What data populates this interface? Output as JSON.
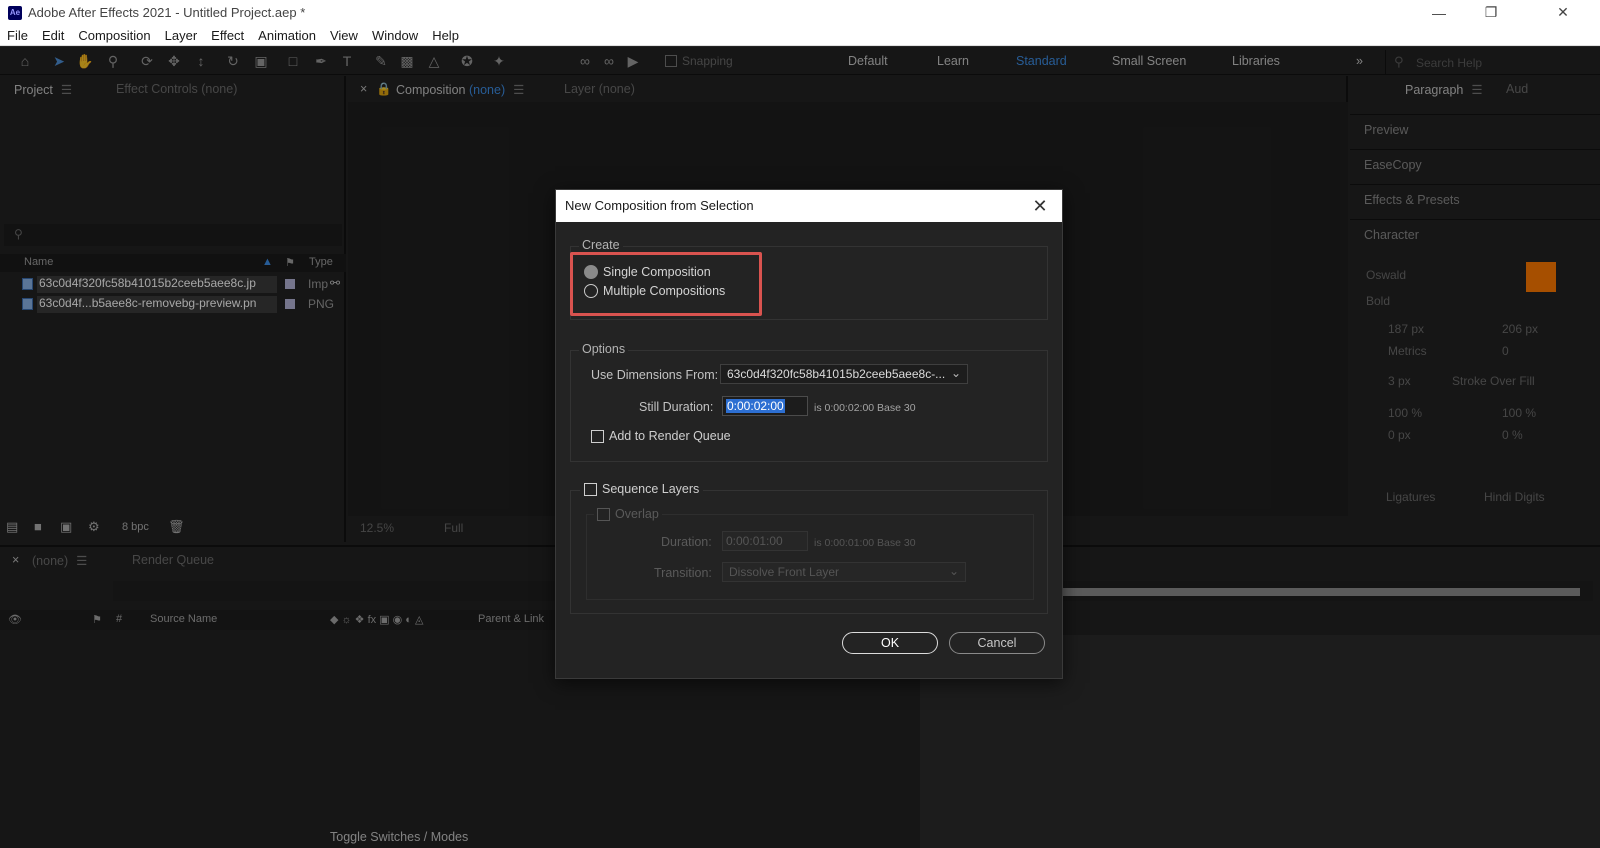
{
  "window": {
    "app_badge": "Ae",
    "title": "Adobe After Effects 2021 - Untitled Project.aep *"
  },
  "menu": [
    "File",
    "Edit",
    "Composition",
    "Layer",
    "Effect",
    "Animation",
    "View",
    "Window",
    "Help"
  ],
  "toolbar": {
    "snapping_label": "Snapping",
    "workspaces": [
      "Default",
      "Learn",
      "Standard",
      "Small Screen",
      "Libraries"
    ],
    "active_workspace": "Standard",
    "search_placeholder": "Search Help"
  },
  "project_panel": {
    "tab_project": "Project",
    "tab_effect_controls": "Effect Controls (none)",
    "col_name": "Name",
    "col_type": "Type",
    "files": [
      {
        "name": "63c0d4f320fc58b41015b2ceeb5aee8c.jp",
        "type": "Imp"
      },
      {
        "name": "63c0d4f...b5aee8c-removebg-preview.pn",
        "type": "PNG"
      }
    ],
    "bpc_label": "8 bpc"
  },
  "composition_panel": {
    "tab_label": "Composition",
    "tab_value": "(none)",
    "layer_tab": "Layer (none)",
    "zoom": "12.5%",
    "resolution": "Full"
  },
  "right_panel": {
    "tabs": [
      "Paragraph",
      "Aud"
    ],
    "sections": [
      "Preview",
      "EaseCopy",
      "Effects & Presets",
      "Character"
    ],
    "font_family": "Oswald",
    "font_style": "Bold",
    "font_size": "187 px",
    "leading": "206 px",
    "kerning": "Metrics",
    "tracking": "0",
    "stroke_width": "3 px",
    "stroke_mode": "Stroke Over Fill",
    "vert_scale": "100 %",
    "horiz_scale": "100 %",
    "baseline_shift": "0 px",
    "tsume": "0 %",
    "ligatures_label": "Ligatures",
    "hindi_digits_label": "Hindi Digits",
    "fill_color": "#ff7a00"
  },
  "timeline": {
    "tab_none": "(none)",
    "tab_render_queue": "Render Queue",
    "col_hash": "#",
    "col_source_name": "Source Name",
    "col_parent_link": "Parent & Link",
    "toggle_label": "Toggle Switches / Modes"
  },
  "dialog": {
    "title": "New Composition from Selection",
    "create_label": "Create",
    "single_composition": "Single Composition",
    "multiple_compositions": "Multiple Compositions",
    "options_label": "Options",
    "use_dimensions_label": "Use Dimensions From:",
    "use_dimensions_value": "63c0d4f320fc58b41015b2ceeb5aee8c-...",
    "still_duration_label": "Still Duration:",
    "still_duration_value": "0:00:02:00",
    "still_duration_note": "is 0:00:02:00  Base 30",
    "add_render_queue_label": "Add to Render Queue",
    "sequence_layers_label": "Sequence Layers",
    "overlap_label": "Overlap",
    "duration_label": "Duration:",
    "duration_value": "0:00:01:00",
    "duration_note": "is 0:00:01:00  Base 30",
    "transition_label": "Transition:",
    "transition_value": "Dissolve Front Layer",
    "ok_label": "OK",
    "cancel_label": "Cancel"
  }
}
